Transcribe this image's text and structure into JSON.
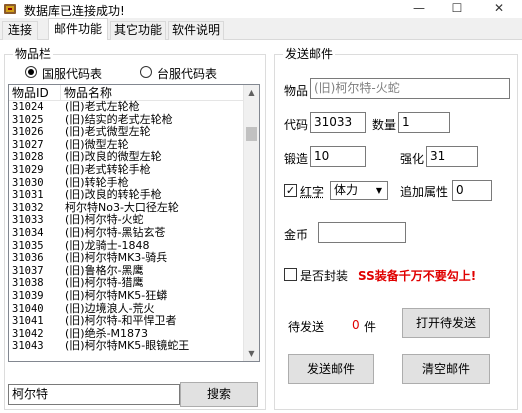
{
  "window": {
    "title": "数据库已连接成功!",
    "minimize_glyph": "—",
    "maximize_glyph": "☐",
    "close_glyph": "✕"
  },
  "tabs": [
    {
      "label": "连接",
      "active": false
    },
    {
      "label": "邮件功能",
      "active": true
    },
    {
      "label": "其它功能",
      "active": false
    },
    {
      "label": "软件说明",
      "active": false
    }
  ],
  "items_panel": {
    "title": "物品栏",
    "radio_options": [
      {
        "label": "国服代码表",
        "checked": true
      },
      {
        "label": "台服代码表",
        "checked": false
      }
    ],
    "columns": [
      "物品ID",
      "物品名称"
    ],
    "rows": [
      {
        "id": "31024",
        "name": "(旧)老式左轮枪"
      },
      {
        "id": "31025",
        "name": "(旧)结实的老式左轮枪"
      },
      {
        "id": "31026",
        "name": "(旧)老式微型左轮"
      },
      {
        "id": "31027",
        "name": "(旧)微型左轮"
      },
      {
        "id": "31028",
        "name": "(旧)改良的微型左轮"
      },
      {
        "id": "31029",
        "name": "(旧)老式转轮手枪"
      },
      {
        "id": "31030",
        "name": "(旧)转轮手枪"
      },
      {
        "id": "31031",
        "name": "(旧)改良的转轮手枪"
      },
      {
        "id": "31032",
        "name": "柯尔特No3-大口径左轮"
      },
      {
        "id": "31033",
        "name": "(旧)柯尔特-火蛇"
      },
      {
        "id": "31034",
        "name": "(旧)柯尔特-黑钻玄苍"
      },
      {
        "id": "31035",
        "name": "(旧)龙骑士-1848"
      },
      {
        "id": "31036",
        "name": "(旧)柯尔特MK3-骑兵"
      },
      {
        "id": "31037",
        "name": "(旧)鲁格尔-黑鹰"
      },
      {
        "id": "31038",
        "name": "(旧)柯尔特-猎鹰"
      },
      {
        "id": "31039",
        "name": "(旧)柯尔特MK5-狂蟒"
      },
      {
        "id": "31040",
        "name": "(旧)边境浪人-荒火"
      },
      {
        "id": "31041",
        "name": "(旧)柯尔特-和平悍卫者"
      },
      {
        "id": "31042",
        "name": "(旧)绝杀-M1873"
      },
      {
        "id": "31043",
        "name": "(旧)柯尔特MK5-眼镜蛇王"
      }
    ],
    "search_value": "柯尔特",
    "search_button": "搜索",
    "scroll_up_glyph": "▲",
    "scroll_down_glyph": "▼"
  },
  "mail_panel": {
    "title": "发送邮件",
    "item_label": "物品",
    "item_value": "(旧)柯尔特-火蛇",
    "code_label": "代码",
    "code_value": "31033",
    "quantity_label": "数量",
    "quantity_value": "1",
    "forge_label": "锻造",
    "forge_value": "10",
    "enhance_label": "强化",
    "enhance_value": "31",
    "red_label": "红字",
    "red_checked": true,
    "checkmark": "✓",
    "attribute_select": "体力",
    "dropdown_glyph": "▼",
    "extra_attr_label": "追加属性",
    "extra_attr_value": "0",
    "gold_label": "金币",
    "gold_value": "",
    "seal_label": "是否封装",
    "seal_checked": false,
    "warning": "SS装备千万不要勾上!",
    "pending_label": "待发送",
    "pending_count": "0",
    "pending_unit": "件",
    "open_pending_button": "打开待发送",
    "send_button": "发送邮件",
    "clear_button": "清空邮件"
  }
}
